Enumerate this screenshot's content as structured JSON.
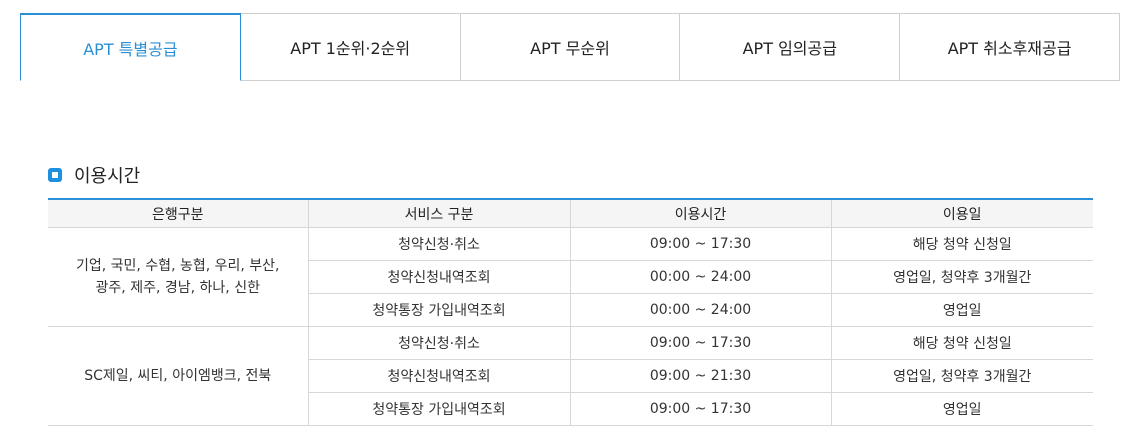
{
  "tabs": [
    {
      "label": "APT 특별공급",
      "active": true
    },
    {
      "label": "APT 1순위·2순위",
      "active": false
    },
    {
      "label": "APT 무순위",
      "active": false
    },
    {
      "label": "APT 임의공급",
      "active": false
    },
    {
      "label": "APT 취소후재공급",
      "active": false
    }
  ],
  "section": {
    "title": "이용시간",
    "icon": "square-bullet-icon"
  },
  "table": {
    "headers": [
      "은행구분",
      "서비스 구분",
      "이용시간",
      "이용일"
    ],
    "groups": [
      {
        "banks": "기업, 국민, 수협, 농협, 우리, 부산, 광주, 제주, 경남, 하나, 신한",
        "rows": [
          {
            "service": "청약신청·취소",
            "time": "09:00 ~ 17:30",
            "day": "해당 청약 신청일"
          },
          {
            "service": "청약신청내역조회",
            "time": "00:00 ~ 24:00",
            "day": "영업일, 청약후 3개월간"
          },
          {
            "service": "청약통장 가입내역조회",
            "time": "00:00 ~ 24:00",
            "day": "영업일"
          }
        ]
      },
      {
        "banks": "SC제일, 씨티, 아이엠뱅크, 전북",
        "rows": [
          {
            "service": "청약신청·취소",
            "time": "09:00 ~ 17:30",
            "day": "해당 청약 신청일"
          },
          {
            "service": "청약신청내역조회",
            "time": "09:00 ~ 21:30",
            "day": "영업일, 청약후 3개월간"
          },
          {
            "service": "청약통장 가입내역조회",
            "time": "09:00 ~ 17:30",
            "day": "영업일"
          }
        ]
      }
    ]
  },
  "colors": {
    "accent": "#2b8fd6",
    "header_bg": "#f5f5f5",
    "border": "#d7d7d7"
  }
}
